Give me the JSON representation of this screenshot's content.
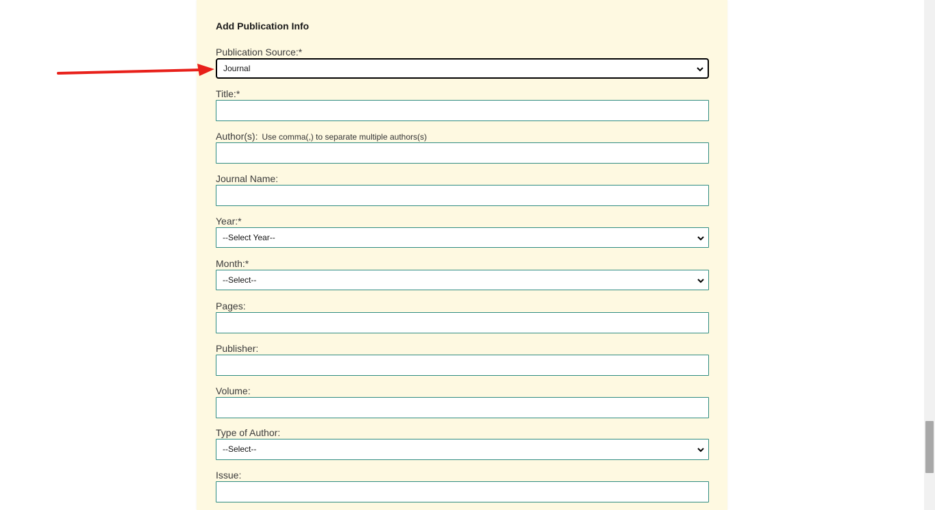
{
  "form": {
    "heading": "Add Publication Info",
    "publication_source": {
      "label": "Publication Source:*",
      "value": "Journal"
    },
    "title": {
      "label": "Title:*",
      "value": ""
    },
    "authors": {
      "label": "Author(s):",
      "hint": "Use comma(,) to separate multiple authors(s)",
      "value": ""
    },
    "journal_name": {
      "label": "Journal Name:",
      "value": ""
    },
    "year": {
      "label": "Year:*",
      "value": "--Select Year--"
    },
    "month": {
      "label": "Month:*",
      "value": "--Select--"
    },
    "pages": {
      "label": "Pages:",
      "value": ""
    },
    "publisher": {
      "label": "Publisher:",
      "value": ""
    },
    "volume": {
      "label": "Volume:",
      "value": ""
    },
    "type_of_author": {
      "label": "Type of Author:",
      "value": "--Select--"
    },
    "issue": {
      "label": "Issue:",
      "value": ""
    }
  },
  "colors": {
    "panel_background": "#fef9e1",
    "field_border": "#2e8b80",
    "annotation_arrow": "#e8201a"
  },
  "icons": {
    "dropdown": "chevron-down-icon",
    "annotation": "red-arrow-icon"
  }
}
